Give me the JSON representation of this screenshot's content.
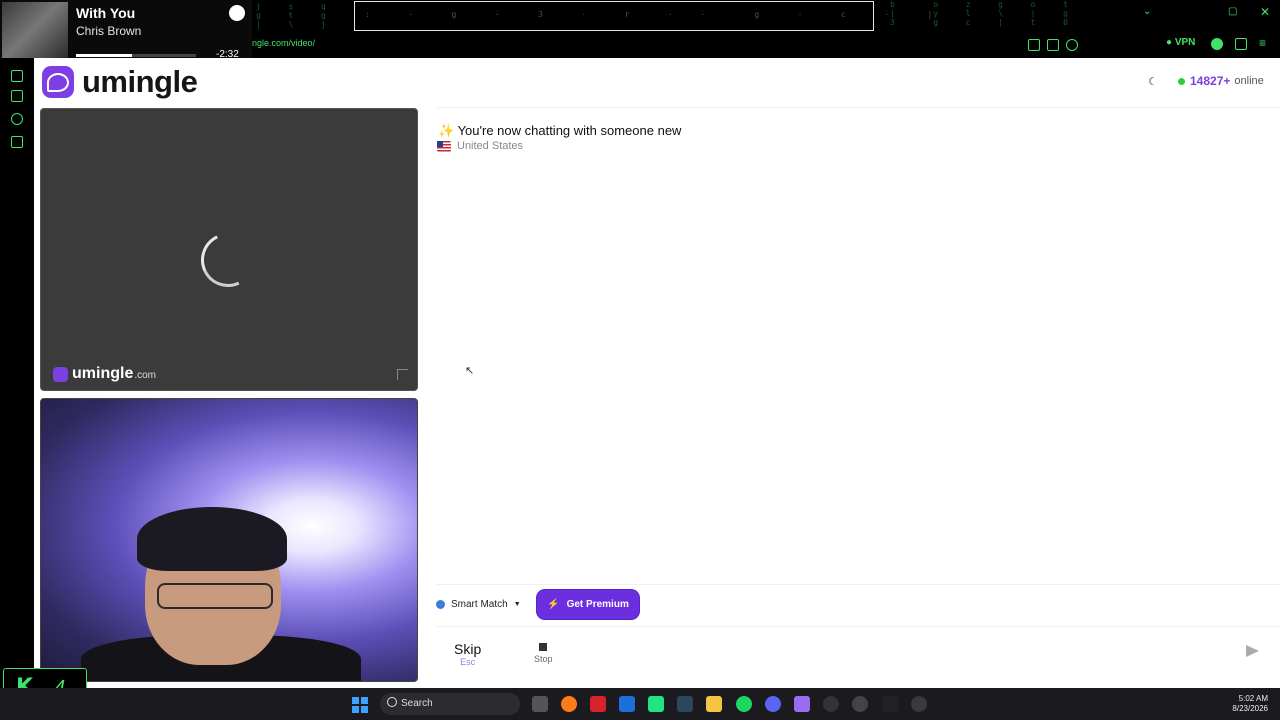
{
  "browser": {
    "url_fragment": "ngle.com/video/",
    "vpn_label": "VPN"
  },
  "spotify": {
    "song": "With You",
    "artist": "Chris Brown",
    "time_remaining": "-2:32",
    "progress": 0.47
  },
  "site": {
    "logo_text": "umingle",
    "online_count": "14827+",
    "online_label": "online"
  },
  "remote_video": {
    "watermark_name": "umingle",
    "watermark_domain": ".com"
  },
  "chat": {
    "status_emoji": "✨",
    "status_text": "You're now chatting with someone new",
    "country": "United States"
  },
  "controls": {
    "match_mode": "Smart Match",
    "premium_label": "Get Premium",
    "skip_label": "Skip",
    "skip_shortcut": "Esc",
    "stop_label": "Stop",
    "message_placeholder": ""
  },
  "widget": {
    "letter": "K",
    "number": "4"
  },
  "taskbar": {
    "search_label": "Search",
    "time": "5:02 AM",
    "date": "8/23/2026",
    "accent": "#3aa3ff"
  },
  "colors": {
    "brand": "#7b3fe4",
    "online_dot": "#2ecc40",
    "terminal_green": "#3fe36a"
  }
}
